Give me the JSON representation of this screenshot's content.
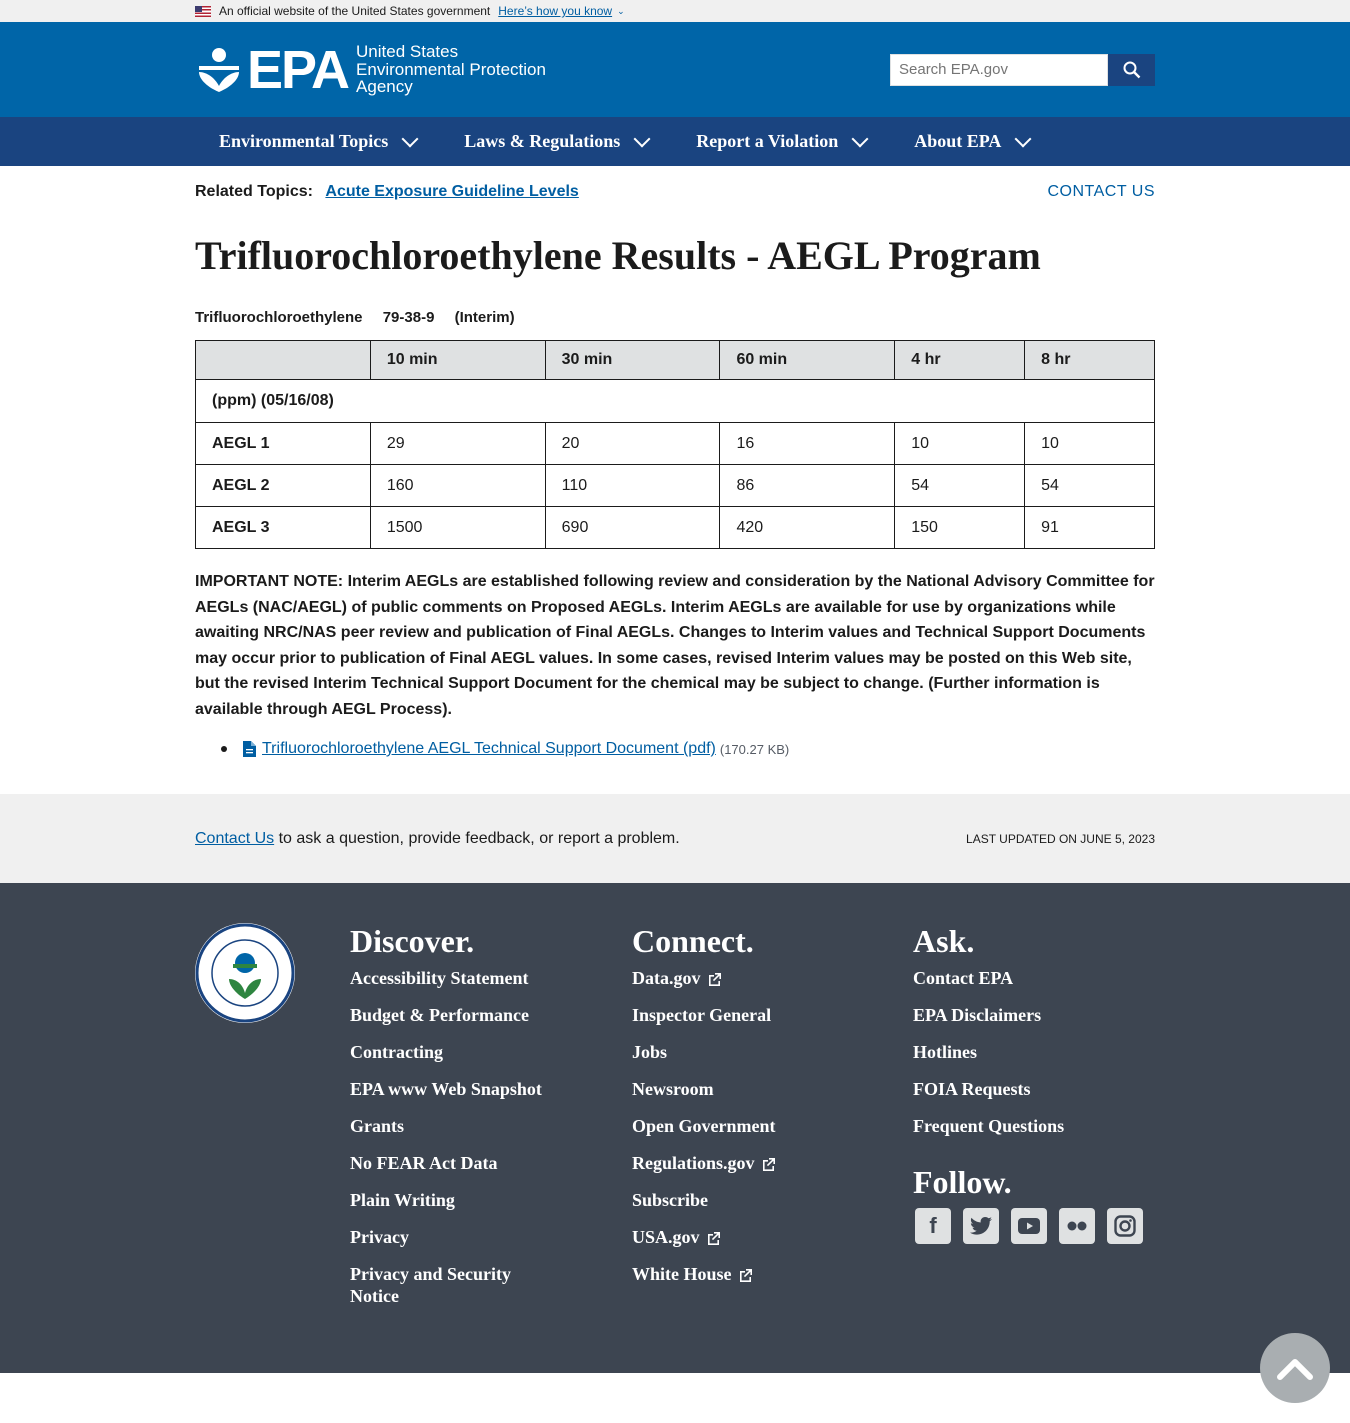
{
  "gov_banner": {
    "text": "An official website of the United States government",
    "link": "Here’s how you know"
  },
  "header": {
    "logo_abbr": "EPA",
    "logo_lines": [
      "United States",
      "Environmental Protection",
      "Agency"
    ],
    "search_placeholder": "Search EPA.gov"
  },
  "nav": {
    "items": [
      "Environmental Topics",
      "Laws & Regulations",
      "Report a Violation",
      "About EPA"
    ]
  },
  "related": {
    "label": "Related Topics:",
    "link": "Acute Exposure Guideline Levels",
    "contact": "CONTACT US"
  },
  "page_title": "Trifluorochloroethylene Results - AEGL Program",
  "chemical": {
    "name": "Trifluorochloroethylene",
    "cas": "79-38-9",
    "status": "(Interim)"
  },
  "table": {
    "headers": [
      "",
      "10 min",
      "30 min",
      "60 min",
      "4 hr",
      "8 hr"
    ],
    "unit_row": "(ppm) (05/16/08)",
    "rows": [
      {
        "label": "AEGL 1",
        "values": [
          "29",
          "20",
          "16",
          "10",
          "10"
        ]
      },
      {
        "label": "AEGL 2",
        "values": [
          "160",
          "110",
          "86",
          "54",
          "54"
        ]
      },
      {
        "label": "AEGL 3",
        "values": [
          "1500",
          "690",
          "420",
          "150",
          "91"
        ]
      }
    ]
  },
  "note": "IMPORTANT NOTE: Interim AEGLs are established following review and consideration by the National Advisory Committee for AEGLs (NAC/AEGL) of public comments on Proposed AEGLs. Interim AEGLs are available for use by organizations while awaiting NRC/NAS peer review and publication of Final AEGLs. Changes to Interim values and Technical Support Documents may occur prior to publication of Final AEGL values. In some cases, revised Interim values may be posted on this Web site, but the revised Interim Technical Support Document for the chemical may be subject to change. (Further information is available through AEGL Process).",
  "document": {
    "link": "Trifluorochloroethylene AEGL Technical Support Document (pdf)",
    "size": "(170.27 KB)"
  },
  "feedback": {
    "link": "Contact Us",
    "text": " to ask a question, provide feedback, or report a problem.",
    "updated": "LAST UPDATED ON JUNE 5, 2023"
  },
  "footer": {
    "discover": {
      "title": "Discover.",
      "links": [
        "Accessibility Statement",
        "Budget & Performance",
        "Contracting",
        "EPA www Web Snapshot",
        "Grants",
        "No FEAR Act Data",
        "Plain Writing",
        "Privacy",
        "Privacy and Security Notice"
      ]
    },
    "connect": {
      "title": "Connect.",
      "links": [
        "Data.gov",
        "Inspector General",
        "Jobs",
        "Newsroom",
        "Open Government",
        "Regulations.gov",
        "Subscribe",
        "USA.gov",
        "White House"
      ]
    },
    "ask": {
      "title": "Ask.",
      "links": [
        "Contact EPA",
        "EPA Disclaimers",
        "Hotlines",
        "FOIA Requests",
        "Frequent Questions"
      ]
    },
    "follow": {
      "title": "Follow.",
      "icons": [
        "facebook-icon",
        "twitter-icon",
        "youtube-icon",
        "flickr-icon",
        "instagram-icon"
      ]
    }
  },
  "colors": {
    "header_blue": "#0065a8",
    "nav_blue": "#1a4480",
    "link_blue": "#005ea2",
    "footer_bg": "#3d4551"
  }
}
